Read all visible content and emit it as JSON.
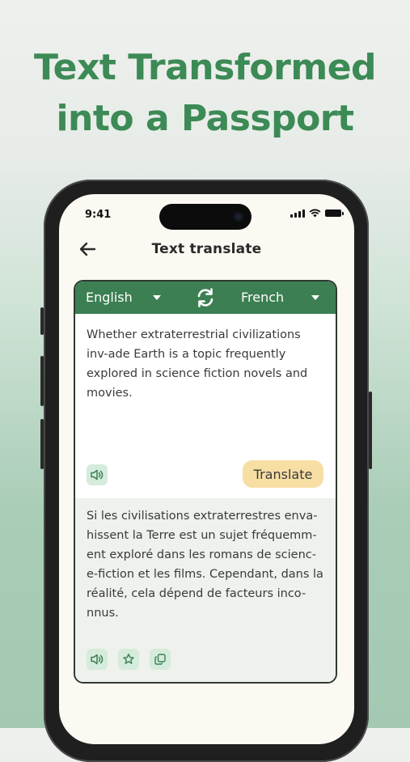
{
  "headline": {
    "line1": "Text Transformed",
    "line2": "into a Passport"
  },
  "status_bar": {
    "time": "9:41"
  },
  "nav": {
    "title": "Text translate",
    "back_icon": "arrow-left-icon"
  },
  "translator": {
    "source_language": "English",
    "target_language": "French",
    "source_text": "Whether extraterrestrial civilizations inv-ade Earth is a topic frequently explored in science fiction novels and movies.",
    "translate_label": "Translate",
    "translated_text": "Si les civilisations extraterrestres enva-hissent la Terre est un sujet fréquemm-ent exploré dans les romans de scienc-e-fiction et les films. Cependant, dans la réalité, cela dépend de facteurs inco-nnus.",
    "colors": {
      "header_green": "#3c7f52",
      "button_yellow": "#f7dea3",
      "chip_green": "#d5ebdc",
      "title_green": "#3c8a55"
    }
  }
}
